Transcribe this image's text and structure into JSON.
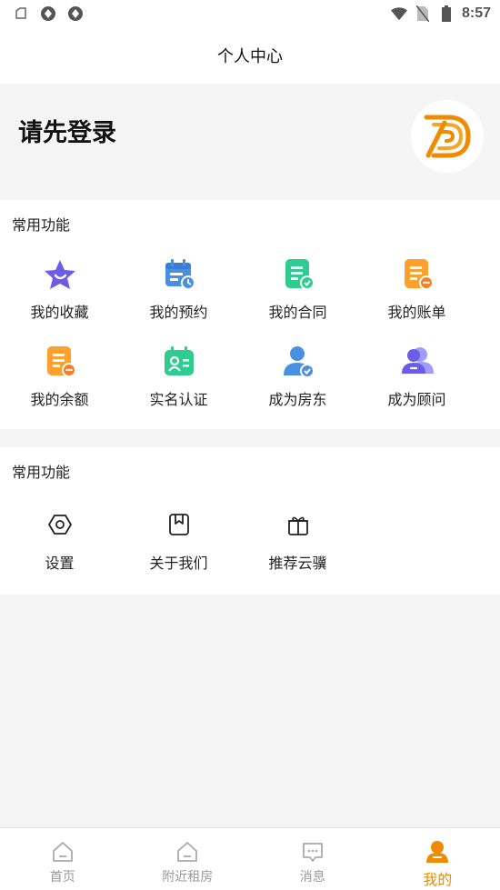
{
  "status_bar": {
    "time": "8:57"
  },
  "header": {
    "title": "个人中心"
  },
  "profile": {
    "login_prompt": "请先登录"
  },
  "section1": {
    "title": "常用功能",
    "items": [
      {
        "label": "我的收藏",
        "icon": "star-icon"
      },
      {
        "label": "我的预约",
        "icon": "calendar-clock-icon"
      },
      {
        "label": "我的合同",
        "icon": "contract-check-icon"
      },
      {
        "label": "我的账单",
        "icon": "bill-icon"
      },
      {
        "label": "我的余额",
        "icon": "balance-icon"
      },
      {
        "label": "实名认证",
        "icon": "id-card-icon"
      },
      {
        "label": "成为房东",
        "icon": "landlord-icon"
      },
      {
        "label": "成为顾问",
        "icon": "advisor-icon"
      }
    ]
  },
  "section2": {
    "title": "常用功能",
    "items": [
      {
        "label": "设置",
        "icon": "settings-icon"
      },
      {
        "label": "关于我们",
        "icon": "about-icon"
      },
      {
        "label": "推荐云骥",
        "icon": "gift-icon"
      }
    ]
  },
  "tabbar": {
    "tabs": [
      {
        "label": "首页",
        "icon": "home-icon"
      },
      {
        "label": "附近租房",
        "icon": "nearby-icon"
      },
      {
        "label": "消息",
        "icon": "message-icon"
      },
      {
        "label": "我的",
        "icon": "profile-icon"
      }
    ],
    "active_index": 3
  },
  "colors": {
    "accent": "#f08a00",
    "purple": "#6c5ce7",
    "blue": "#4a90e2",
    "green": "#2ecc8f",
    "orange": "#ff9f2e"
  }
}
